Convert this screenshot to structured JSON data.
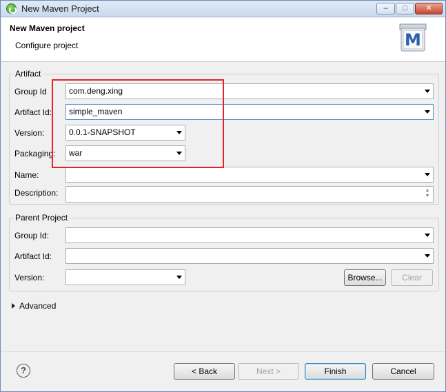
{
  "window": {
    "title": "New Maven Project",
    "minimize_glyph": "–",
    "maximize_glyph": "□",
    "close_glyph": "✕"
  },
  "header": {
    "title": "New Maven project",
    "subtitle": "Configure project",
    "logo_letter": "M"
  },
  "artifact": {
    "group_label": "Artifact",
    "group_id_label": "Group Id",
    "group_id_value": "com.deng.xing",
    "artifact_id_label": "Artifact Id:",
    "artifact_id_value": "simple_maven",
    "version_label": "Version:",
    "version_value": "0.0.1-SNAPSHOT",
    "packaging_label": "Packaging:",
    "packaging_value": "war",
    "name_label": "Name:",
    "name_value": "",
    "description_label": "Description:",
    "description_value": ""
  },
  "parent": {
    "group_label": "Parent Project",
    "group_id_label": "Group Id:",
    "group_id_value": "",
    "artifact_id_label": "Artifact Id:",
    "artifact_id_value": "",
    "version_label": "Version:",
    "version_value": "",
    "browse_label": "Browse...",
    "clear_label": "Clear"
  },
  "advanced": {
    "label": "Advanced"
  },
  "footer": {
    "help_glyph": "?",
    "back_label": "< Back",
    "next_label": "Next >",
    "finish_label": "Finish",
    "cancel_label": "Cancel"
  },
  "colors": {
    "highlight": "#e8222a",
    "focus": "#5b93cf"
  }
}
